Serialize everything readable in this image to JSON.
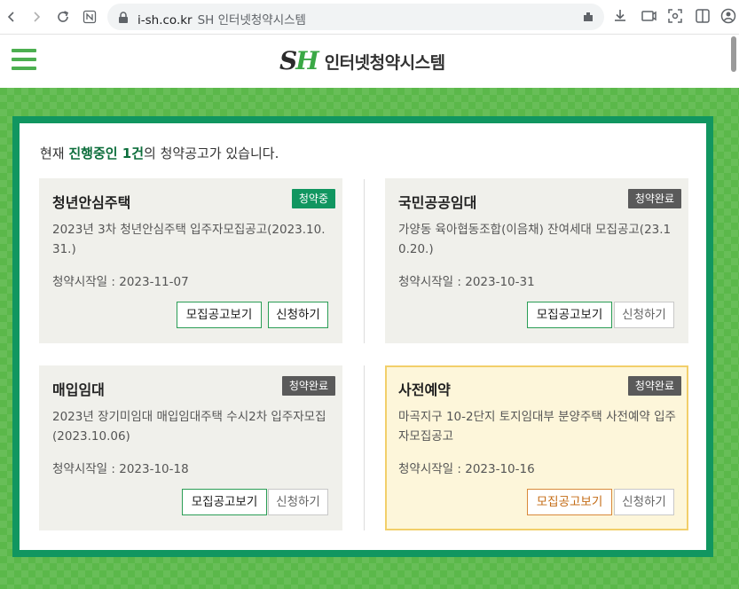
{
  "browser": {
    "url": "i-sh.co.kr",
    "tab_title": "SH 인터넷청약시스템"
  },
  "header": {
    "logo_mark_s": "S",
    "logo_mark_h": "H",
    "logo_title": "인터넷청약시스템"
  },
  "intro": {
    "prefix": "현재 ",
    "highlight": "진행중인 1건",
    "suffix": "의 청약공고가 있습니다."
  },
  "cards": [
    {
      "title": "청년안심주택",
      "badge": "청약중",
      "status": "active",
      "description": "2023년 3차 청년안심주택 입주자모집공고(2023.10.31.)",
      "date": "청약시작일 : 2023-11-07",
      "view_label": "모집공고보기",
      "apply_label": "신청하기"
    },
    {
      "title": "국민공공임대",
      "badge": "청약완료",
      "status": "closed",
      "description": "가양동 육아협동조합(이음채) 잔여세대 모집공고(23.10.20.)",
      "date": "청약시작일 : 2023-10-31",
      "view_label": "모집공고보기",
      "apply_label": "신청하기"
    },
    {
      "title": "매입임대",
      "badge": "청약완료",
      "status": "closed",
      "description": "2023년 장기미임대 매입임대주택 수시2차 입주자모집(2023.10.06)",
      "date": "청약시작일 : 2023-10-18",
      "view_label": "모집공고보기",
      "apply_label": "신청하기"
    },
    {
      "title": "사전예약",
      "badge": "청약완료",
      "status": "closed",
      "description": "마곡지구 10-2단지 토지임대부 분양주택 사전예약 입주자모집공고",
      "date": "청약시작일 : 2023-10-16",
      "view_label": "모집공고보기",
      "apply_label": "신청하기"
    }
  ],
  "colors": {
    "brand_green": "#119660",
    "field_green": "#5bb84a",
    "highlight_border": "#f2cf6a",
    "highlight_bg": "#fdf6da"
  }
}
